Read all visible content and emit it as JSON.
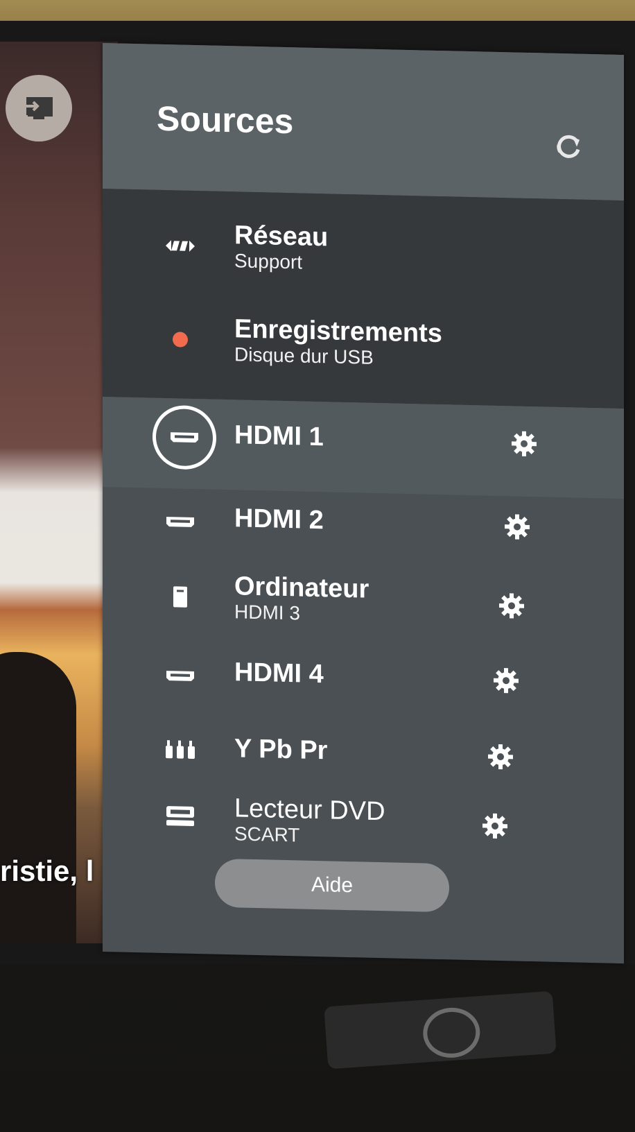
{
  "overlay": {
    "subtitle_text": "ristie, l"
  },
  "panel": {
    "title": "Sources",
    "refresh_icon": "refresh-icon",
    "help_label": "Aide"
  },
  "sources": [
    {
      "name": "Réseau",
      "sub": "Support",
      "icon": "network-icon",
      "settings": false
    },
    {
      "name": "Enregistrements",
      "sub": "Disque dur USB",
      "icon": "record-dot-icon",
      "settings": false
    },
    {
      "name": "HDMI 1",
      "sub": "",
      "icon": "hdmi-icon",
      "settings": true,
      "selected": true
    },
    {
      "name": "HDMI 2",
      "sub": "",
      "icon": "hdmi-icon",
      "settings": true
    },
    {
      "name": "Ordinateur",
      "sub": "HDMI 3",
      "icon": "computer-icon",
      "settings": true
    },
    {
      "name": "HDMI 4",
      "sub": "",
      "icon": "hdmi-icon",
      "settings": true
    },
    {
      "name": "Y Pb Pr",
      "sub": "",
      "icon": "component-icon",
      "settings": true
    },
    {
      "name": "Lecteur DVD",
      "sub": "SCART",
      "icon": "dvd-icon",
      "settings": true
    }
  ],
  "colors": {
    "panel_bg": "#4a5054",
    "header_bg": "#5c6367",
    "dark_section_bg": "#36393b",
    "record_dot": "#f26b4e"
  }
}
